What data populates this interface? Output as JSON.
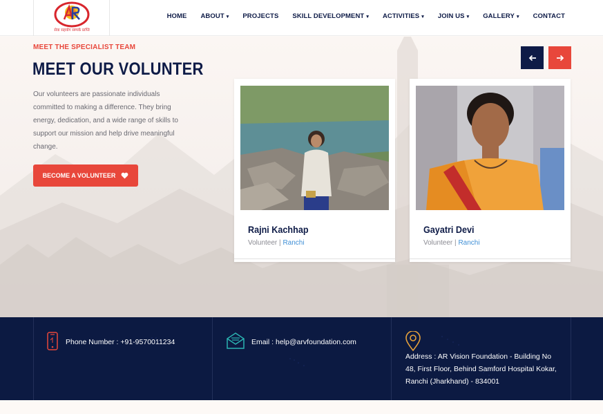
{
  "header": {
    "logo_tagline": "सेवा सहयोग सम्पर्क प्राप्ति",
    "logo_letters": "AR",
    "nav": [
      {
        "label": "HOME",
        "has_dropdown": false
      },
      {
        "label": "ABOUT",
        "has_dropdown": true
      },
      {
        "label": "PROJECTS",
        "has_dropdown": false
      },
      {
        "label": "SKILL DEVELOPMENT",
        "has_dropdown": true
      },
      {
        "label": "ACTIVITIES",
        "has_dropdown": true
      },
      {
        "label": "JOIN US",
        "has_dropdown": true
      },
      {
        "label": "GALLERY",
        "has_dropdown": true
      },
      {
        "label": "CONTACT",
        "has_dropdown": false
      }
    ],
    "caret": "▾"
  },
  "hero": {
    "eyebrow": "MEET THE SPECIALIST TEAM",
    "title": "MEET OUR VOLUNTER",
    "description": "Our volunteers are passionate individuals committed to making a difference. They bring energy, dedication, and a wide range of skills to support our mission and help drive meaningful change.",
    "button_label": "BECOME A VOLUNTEER",
    "button_icon": "heart-icon",
    "prev_icon": "arrow-left-icon",
    "next_icon": "arrow-right-icon"
  },
  "volunteers": [
    {
      "name": "Rajni Kachhap",
      "role": "Volunteer",
      "separator": "|",
      "city": "Ranchi"
    },
    {
      "name": "Gayatri Devi",
      "role": "Volunteer",
      "separator": "|",
      "city": "Ranchi"
    }
  ],
  "contact": {
    "phone": "Phone Number : +91-9570011234",
    "email": "Email : help@arvfoundation.com",
    "address": "Address : AR Vision Foundation - Building No 48, First Floor, Behind Samford Hospital Kokar, Ranchi (Jharkhand) - 834001",
    "phone_icon": "phone-icon",
    "email_icon": "envelope-icon",
    "address_icon": "location-pin-icon"
  },
  "colors": {
    "navy": "#0e1b47",
    "accent": "#e8473b",
    "link_blue": "#3f8fd6",
    "footer_bg": "#0c1a42",
    "icon_orange": "#e8a23b",
    "icon_teal": "#2bb3b1"
  }
}
